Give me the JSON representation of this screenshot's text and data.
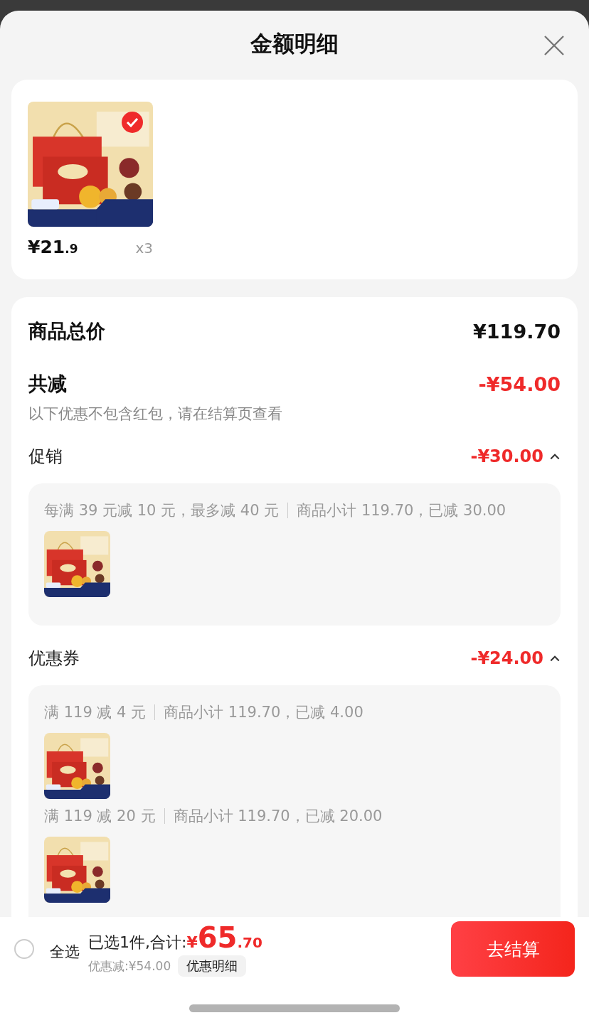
{
  "title": "金额明细",
  "product": {
    "kind": "picture",
    "selected": true,
    "price": "¥21",
    "price_fraction": ".9",
    "quantity": "x3"
  },
  "summary": {
    "total_label": "商品总价",
    "total_value": "¥119.70",
    "discount_label": "共减",
    "discount_value": "-¥54.00",
    "note": "以下优惠不包含红包，请在结算页查看"
  },
  "sections": [
    {
      "label": "促销",
      "amount": "-¥30.00",
      "expanded": true,
      "rules": [
        {
          "condition": "每满 39 元减 10 元，最多减 40 元",
          "detail": "商品小计 119.70，已减 30.00"
        }
      ]
    },
    {
      "label": "优惠券",
      "amount": "-¥24.00",
      "expanded": true,
      "rules": [
        {
          "condition": "满 119 减 4 元",
          "detail": "商品小计 119.70，已减 4.00"
        },
        {
          "condition": "满 119 减 20 元",
          "detail": "商品小计 119.70，已减 20.00"
        }
      ]
    }
  ],
  "footer": {
    "select_all_checked": false,
    "select_all_label": "全选",
    "selected_text": "已选1件,合计:",
    "currency": "¥",
    "total_integer": "65",
    "total_fraction": ".70",
    "discount_text": "优惠减:¥54.00",
    "detail_chip": "优惠明细",
    "checkout_button": "去结算"
  }
}
